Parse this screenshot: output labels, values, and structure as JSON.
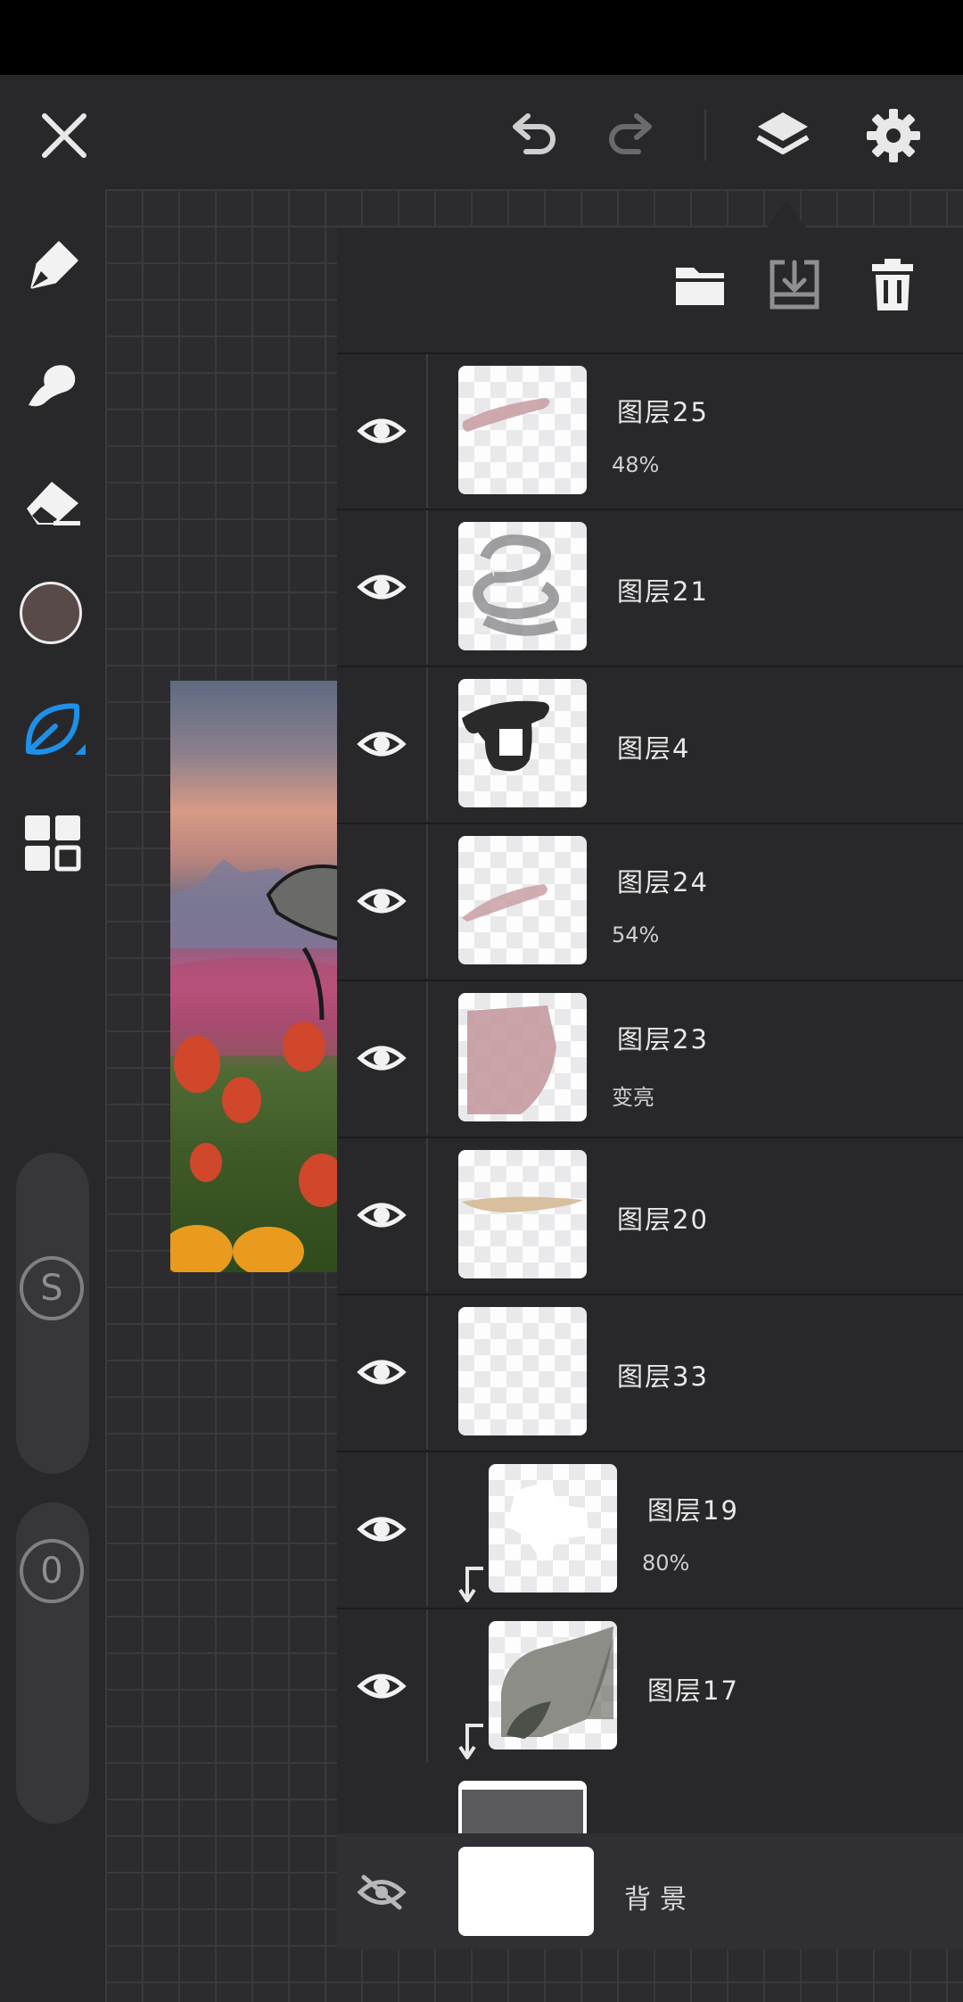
{
  "toolbar": {
    "close_icon": "close-icon",
    "undo_icon": "undo-icon",
    "redo_icon": "redo-icon",
    "layers_icon": "layers-icon",
    "settings_icon": "gear-icon"
  },
  "sidebar": {
    "tools": [
      "pencil-icon",
      "smudge-icon",
      "eraser-icon",
      "color-swatch",
      "leaf-brush-icon",
      "grid-icon"
    ],
    "current_color": "#574a48",
    "active_tool_color": "#1e90e8",
    "size_slider_label": "S",
    "opacity_slider_label": "0"
  },
  "layers_panel": {
    "actions": [
      "folder-icon",
      "merge-down-icon",
      "trash-icon"
    ],
    "layers": [
      {
        "name": "图层25",
        "sub": "48%",
        "visible": true,
        "clipped": false
      },
      {
        "name": "图层21",
        "sub": "",
        "visible": true,
        "clipped": false
      },
      {
        "name": "图层4",
        "sub": "",
        "visible": true,
        "clipped": false
      },
      {
        "name": "图层24",
        "sub": "54%",
        "visible": true,
        "clipped": false
      },
      {
        "name": "图层23",
        "sub": "变亮",
        "visible": true,
        "clipped": false
      },
      {
        "name": "图层20",
        "sub": "",
        "visible": true,
        "clipped": false
      },
      {
        "name": "图层33",
        "sub": "",
        "visible": true,
        "clipped": false
      },
      {
        "name": "图层19",
        "sub": "80%",
        "visible": true,
        "clipped": true
      },
      {
        "name": "图层17",
        "sub": "",
        "visible": true,
        "clipped": true
      }
    ],
    "background": {
      "name": "背景",
      "visible": false
    }
  }
}
